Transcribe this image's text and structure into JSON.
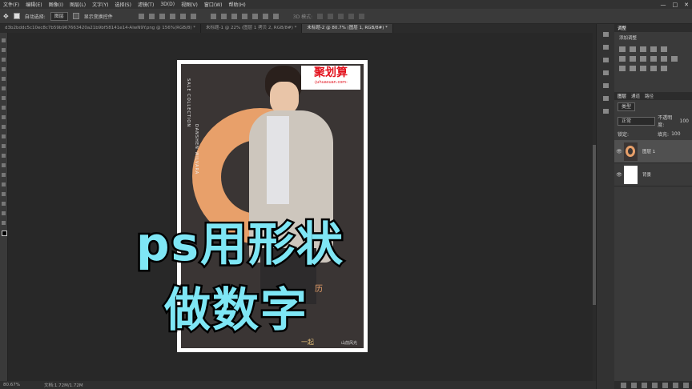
{
  "menu": [
    "文件(F)",
    "编辑(E)",
    "图像(I)",
    "图层(L)",
    "文字(Y)",
    "选择(S)",
    "滤镜(T)",
    "3D(D)",
    "视图(V)",
    "窗口(W)",
    "帮助(H)"
  ],
  "options": {
    "auto_select": "自动选择:",
    "layer_select": "图层",
    "show_transform": "显示变换控件",
    "mode_3d": "3D 模式:"
  },
  "tabs": [
    "d3b2bddc5c10ec8c7b59b967663420a21b9bf58141e14-AlwN9Y.png @ 156%(RGB/8) *",
    "未标题-1 @ 22% (图层 1 拷贝 2, RGB/8#) *",
    "未标题-2 @ 80.7% (图层 1, RGB/8#) *"
  ],
  "active_tab_index": 2,
  "poster": {
    "logo_main": "聚划算",
    "logo_sub": "-juhuasuan.com-",
    "vertical_left_1": "SALE COLLECTION",
    "vertical_left_2": "DANSHEN WILVARA",
    "bottom_left": "一起",
    "bottom_right": "山前风光",
    "partial_text": "历"
  },
  "overlay_title": {
    "line1": "ps用形状",
    "line2": "做数字"
  },
  "status": {
    "zoom": "80.67%",
    "doc": "文档:1.72M/1.72M"
  },
  "window_controls": [
    "—",
    "□",
    "✕"
  ],
  "panels": {
    "adjust_tabs": [
      "调整"
    ],
    "adjust_add": "添加调整",
    "layer_tabs": [
      "图层",
      "通道",
      "路径"
    ],
    "kind_label": "类型",
    "blend_mode": "正常",
    "opacity_label": "不透明度:",
    "opacity_value": "100",
    "lock_label": "锁定:",
    "fill_label": "填充:",
    "fill_value": "100",
    "layers": [
      {
        "name": "图层 1",
        "selected": true
      },
      {
        "name": "背景",
        "selected": false
      }
    ]
  },
  "colors": {
    "accent_title": "#7ee6f5",
    "ring": "#e8a06a",
    "logo_red": "#e3111d"
  }
}
